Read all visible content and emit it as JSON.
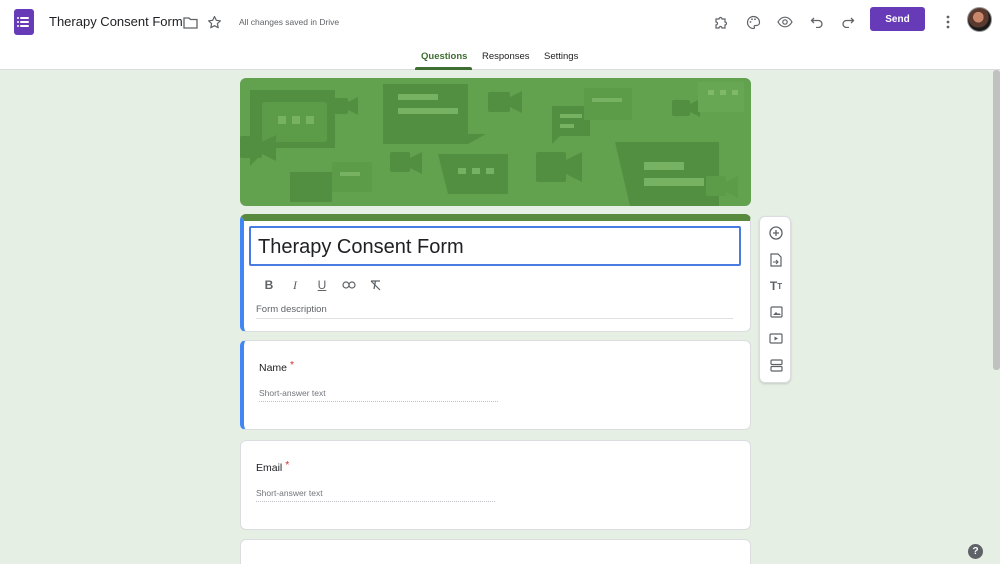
{
  "header": {
    "title": "Therapy Consent Form",
    "saved_status": "All changes saved in Drive",
    "send_label": "Send"
  },
  "tabs": [
    {
      "label": "Questions",
      "active": true
    },
    {
      "label": "Responses",
      "active": false
    },
    {
      "label": "Settings",
      "active": false
    }
  ],
  "form": {
    "title": "Therapy Consent Form",
    "description_placeholder": "Form description",
    "questions": [
      {
        "label": "Name",
        "required_mark": "*",
        "answer_placeholder": "Short-answer text"
      },
      {
        "label": "Email",
        "required_mark": "*",
        "answer_placeholder": "Short-answer text"
      }
    ]
  },
  "help_label": "?",
  "colors": {
    "accent": "#673ab7",
    "theme": "#57893f",
    "banner": "#62a14e",
    "background": "#e6efe3",
    "focus": "#4285f4",
    "required": "#d93025"
  },
  "icons": {
    "header": [
      "forms-app-icon",
      "folder-icon",
      "star-icon",
      "addon-puzzle-icon",
      "palette-icon",
      "preview-eye-icon",
      "undo-icon",
      "redo-icon",
      "more-vert-icon"
    ],
    "format": [
      "bold-icon",
      "italic-icon",
      "underline-icon",
      "link-icon",
      "clear-format-icon"
    ],
    "side_toolbar": [
      "add-question-icon",
      "import-questions-icon",
      "add-title-icon",
      "add-image-icon",
      "add-video-icon",
      "add-section-icon"
    ]
  }
}
